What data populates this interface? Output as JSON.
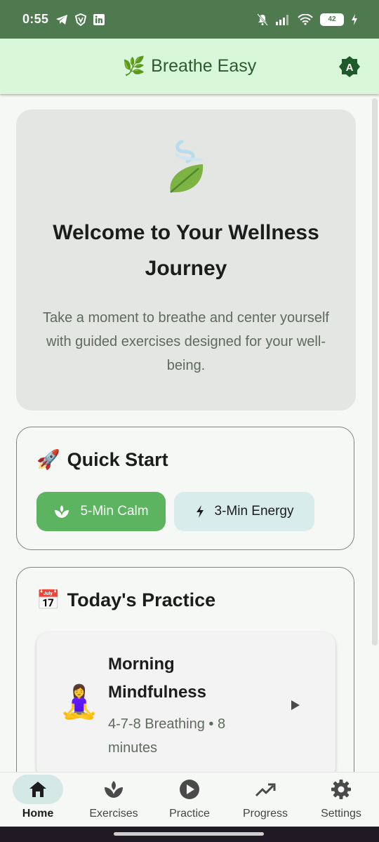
{
  "status_bar": {
    "time": "0:55",
    "battery": "42",
    "left_icons": [
      "telegram-icon",
      "vpn-shield-icon",
      "linkedin-icon"
    ],
    "right_icons": [
      "mute-bell-icon",
      "signal-icon",
      "wifi-icon",
      "battery-icon",
      "charging-icon"
    ]
  },
  "app_bar": {
    "icon": "🌿",
    "title": "Breathe Easy",
    "badge_letter": "A"
  },
  "welcome": {
    "title": "Welcome to Your Wellness Journey",
    "description": "Take a moment to breathe and center yourself with guided exercises designed for your well-being."
  },
  "quick_start": {
    "icon": "🚀",
    "title": "Quick Start",
    "calm_label": "5-Min Calm",
    "energy_label": "3-Min Energy"
  },
  "todays_practice": {
    "icon": "📅",
    "title": "Today's Practice",
    "session": {
      "emoji": "🧘‍♀️",
      "title": "Morning Mindfulness",
      "subtitle": "4-7-8 Breathing • 8 minutes"
    }
  },
  "bottom_nav": {
    "items": [
      {
        "label": "Home",
        "icon": "home-icon",
        "active": true
      },
      {
        "label": "Exercises",
        "icon": "spa-icon",
        "active": false
      },
      {
        "label": "Practice",
        "icon": "play-circle-icon",
        "active": false
      },
      {
        "label": "Progress",
        "icon": "trending-up-icon",
        "active": false
      },
      {
        "label": "Settings",
        "icon": "gear-icon",
        "active": false
      }
    ]
  },
  "colors": {
    "status_bar": "#4f7a4f",
    "app_bar": "#d9f8d9",
    "primary_button": "#5cb360",
    "secondary_button": "#d9ecec",
    "nav_active": "#d4e8e6"
  }
}
